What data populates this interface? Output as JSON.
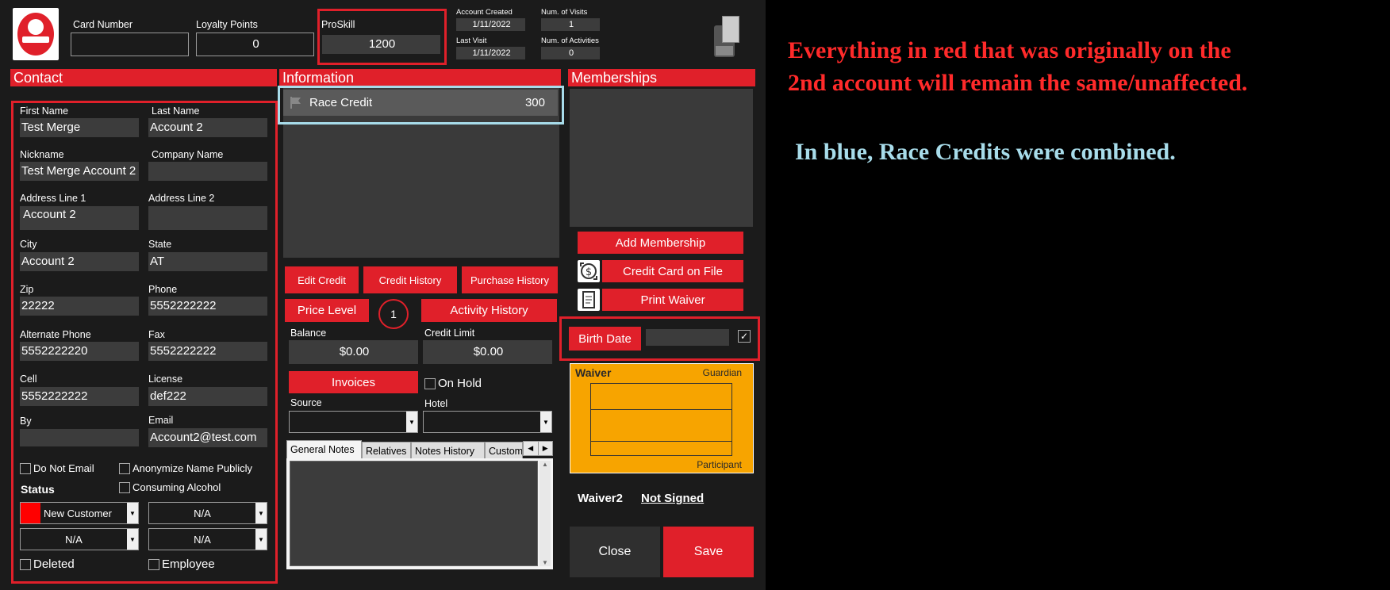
{
  "header": {
    "card_number_label": "Card Number",
    "card_number_value": "",
    "loyalty_points_label": "Loyalty Points",
    "loyalty_points_value": "0",
    "proskill_label": "ProSkill",
    "proskill_value": "1200",
    "account_created_label": "Account Created",
    "account_created_value": "1/11/2022",
    "last_visit_label": "Last Visit",
    "last_visit_value": "1/11/2022",
    "num_visits_label": "Num. of Visits",
    "num_visits_value": "1",
    "num_activities_label": "Num. of Activities",
    "num_activities_value": "0"
  },
  "contact": {
    "title": "Contact",
    "first_name_label": "First Name",
    "first_name": "Test Merge",
    "last_name_label": "Last Name",
    "last_name": "Account 2",
    "nickname_label": "Nickname",
    "nickname": "Test Merge Account 2",
    "company_label": "Company Name",
    "company": "",
    "address1_label": "Address Line 1",
    "address1": "Account 2",
    "address2_label": "Address Line 2",
    "address2": "",
    "city_label": "City",
    "city": "Account 2",
    "state_label": "State",
    "state": "AT",
    "zip_label": "Zip",
    "zip": "22222",
    "phone_label": "Phone",
    "phone": "5552222222",
    "alt_phone_label": "Alternate Phone",
    "alt_phone": "5552222220",
    "fax_label": "Fax",
    "fax": "5552222222",
    "cell_label": "Cell",
    "cell": "5552222222",
    "license_label": "License",
    "license": "def222",
    "by_label": "By",
    "by": "",
    "email_label": "Email",
    "email": "Account2@test.com",
    "do_not_email": "Do Not Email",
    "anonymize": "Anonymize Name Publicly",
    "consuming_alcohol": "Consuming Alcohol",
    "status_label": "Status",
    "status_value": "New Customer",
    "status_color": "#ff0000",
    "dd2": "N/A",
    "dd3": "N/A",
    "dd4": "N/A",
    "deleted": "Deleted",
    "employee": "Employee"
  },
  "information": {
    "title": "Information",
    "credits": [
      {
        "name": "Race Credit",
        "amount": "300",
        "icon": "flag-icon"
      }
    ],
    "edit_credit": "Edit Credit",
    "credit_history": "Credit History",
    "purchase_history": "Purchase History",
    "price_level": "Price Level",
    "price_level_badge": "1",
    "activity_history": "Activity History",
    "balance_label": "Balance",
    "balance": "$0.00",
    "credit_limit_label": "Credit Limit",
    "credit_limit": "$0.00",
    "invoices": "Invoices",
    "on_hold": "On Hold",
    "source_label": "Source",
    "hotel_label": "Hotel",
    "tabs": [
      "General Notes",
      "Relatives",
      "Notes History",
      "Custom"
    ]
  },
  "memberships": {
    "title": "Memberships",
    "add_membership": "Add Membership",
    "credit_card_on_file": "Credit Card on File",
    "print_waiver": "Print Waiver",
    "birth_date": "Birth Date",
    "birth_date_value": "",
    "birth_date_checked": "✓",
    "waiver_title": "Waiver",
    "waiver_guardian": "Guardian",
    "waiver_participant": "Participant",
    "waiver2_label": "Waiver2",
    "waiver2_status": "Not Signed",
    "close": "Close",
    "save": "Save"
  },
  "annotations": {
    "red_line1": "Everything in red that was originally on the",
    "red_line2": "2nd account will remain the same/unaffected.",
    "blue_line": "In blue, Race Credits were combined.",
    "red_color": "#ff2a2a",
    "blue_color": "#a8dcea"
  },
  "colors": {
    "accent": "#e0202a",
    "panel": "#1b1b1b",
    "field": "#3c3c3c",
    "waiver": "#f7a400"
  }
}
